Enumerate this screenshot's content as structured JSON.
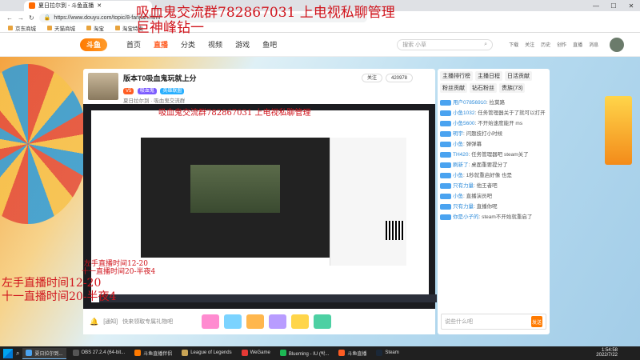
{
  "browser": {
    "tab_title": "夏日拉尔到 - 斗鱼直播",
    "url": "https://www.douyu.com/topic/8-fanjian.html",
    "bookmarks": [
      "京东商城",
      "天猫商城",
      "淘宝",
      "淘宝特卖"
    ],
    "window_controls": [
      "—",
      "☐",
      "✕"
    ]
  },
  "site": {
    "logo": "斗鱼",
    "nav": [
      "首页",
      "直播",
      "分类",
      "视频",
      "游戏",
      "鱼吧"
    ],
    "search_placeholder": "搜索 小草",
    "top_icons": [
      "下载",
      "关注",
      "历史",
      "创作",
      "直播",
      "消息"
    ]
  },
  "room": {
    "title": "版本T0吸血鬼玩就上分",
    "host": "夏日拉尔到",
    "meta": "吸血鬼交流群",
    "tags": [
      "V5",
      "吸血鬼",
      "英雄联盟"
    ],
    "follow": "关注",
    "fans": "420978",
    "comment_prefix": "[通知]",
    "comment_text": "快来领取专属礼物吧"
  },
  "chat": {
    "tabs": [
      "主播排行榜",
      "主播日程",
      "日活贡献",
      "粉丝贡献",
      "钻石粉丝",
      "贵族(73)"
    ],
    "messages": [
      {
        "user": "用户07856910",
        "text": "拉莫路"
      },
      {
        "user": "小鱼1032",
        "text": "任务管理器关于了就可以打开"
      },
      {
        "user": "小鱼5600",
        "text": "不开始速度能开 ms"
      },
      {
        "user": "明宇",
        "text": "问题技打小时候"
      },
      {
        "user": "小鱼",
        "text": "弹弹幕"
      },
      {
        "user": "TH420",
        "text": "任务管理器吧 steam关了"
      },
      {
        "user": "刷新了",
        "text": "桌面重要提分了"
      },
      {
        "user": "小鱼",
        "text": "1秒就重启好像 也是"
      },
      {
        "user": "只有力量",
        "text": "他王者吧"
      },
      {
        "user": "小鱼",
        "text": "直播演员吧"
      },
      {
        "user": "只有力量",
        "text": "直播你呢"
      },
      {
        "user": "你是小子的",
        "text": "steam不开始就重启了"
      }
    ],
    "input_placeholder": "说些什么吧",
    "send": "发送"
  },
  "overlay": {
    "line1": "吸血鬼交流群782867031 上电视私聊管理",
    "line2": "巨神峰钻一",
    "line3": "吸血鬼交流群782867031 上电视私聊管理",
    "line4": "左手直播时间12-20",
    "line5": "十一直播时间20-半夜4",
    "line6": "左手直播时间12-20",
    "line7": "十一直播时间20-半夜4"
  },
  "taskbar": {
    "items": [
      "夏日拉尔到...",
      "OBS 27.2.4 (64-bit...",
      "斗鱼直播伴侣",
      "League of Legends",
      "WeGame",
      "Blueming - IU (박...",
      "斗鱼直播",
      "Steam"
    ],
    "time": "1:54:58",
    "date": "2022/7/22"
  },
  "colors": {
    "accent": "#ff5d23",
    "overlay_red": "#d0141c",
    "taskbar": "#202020"
  }
}
